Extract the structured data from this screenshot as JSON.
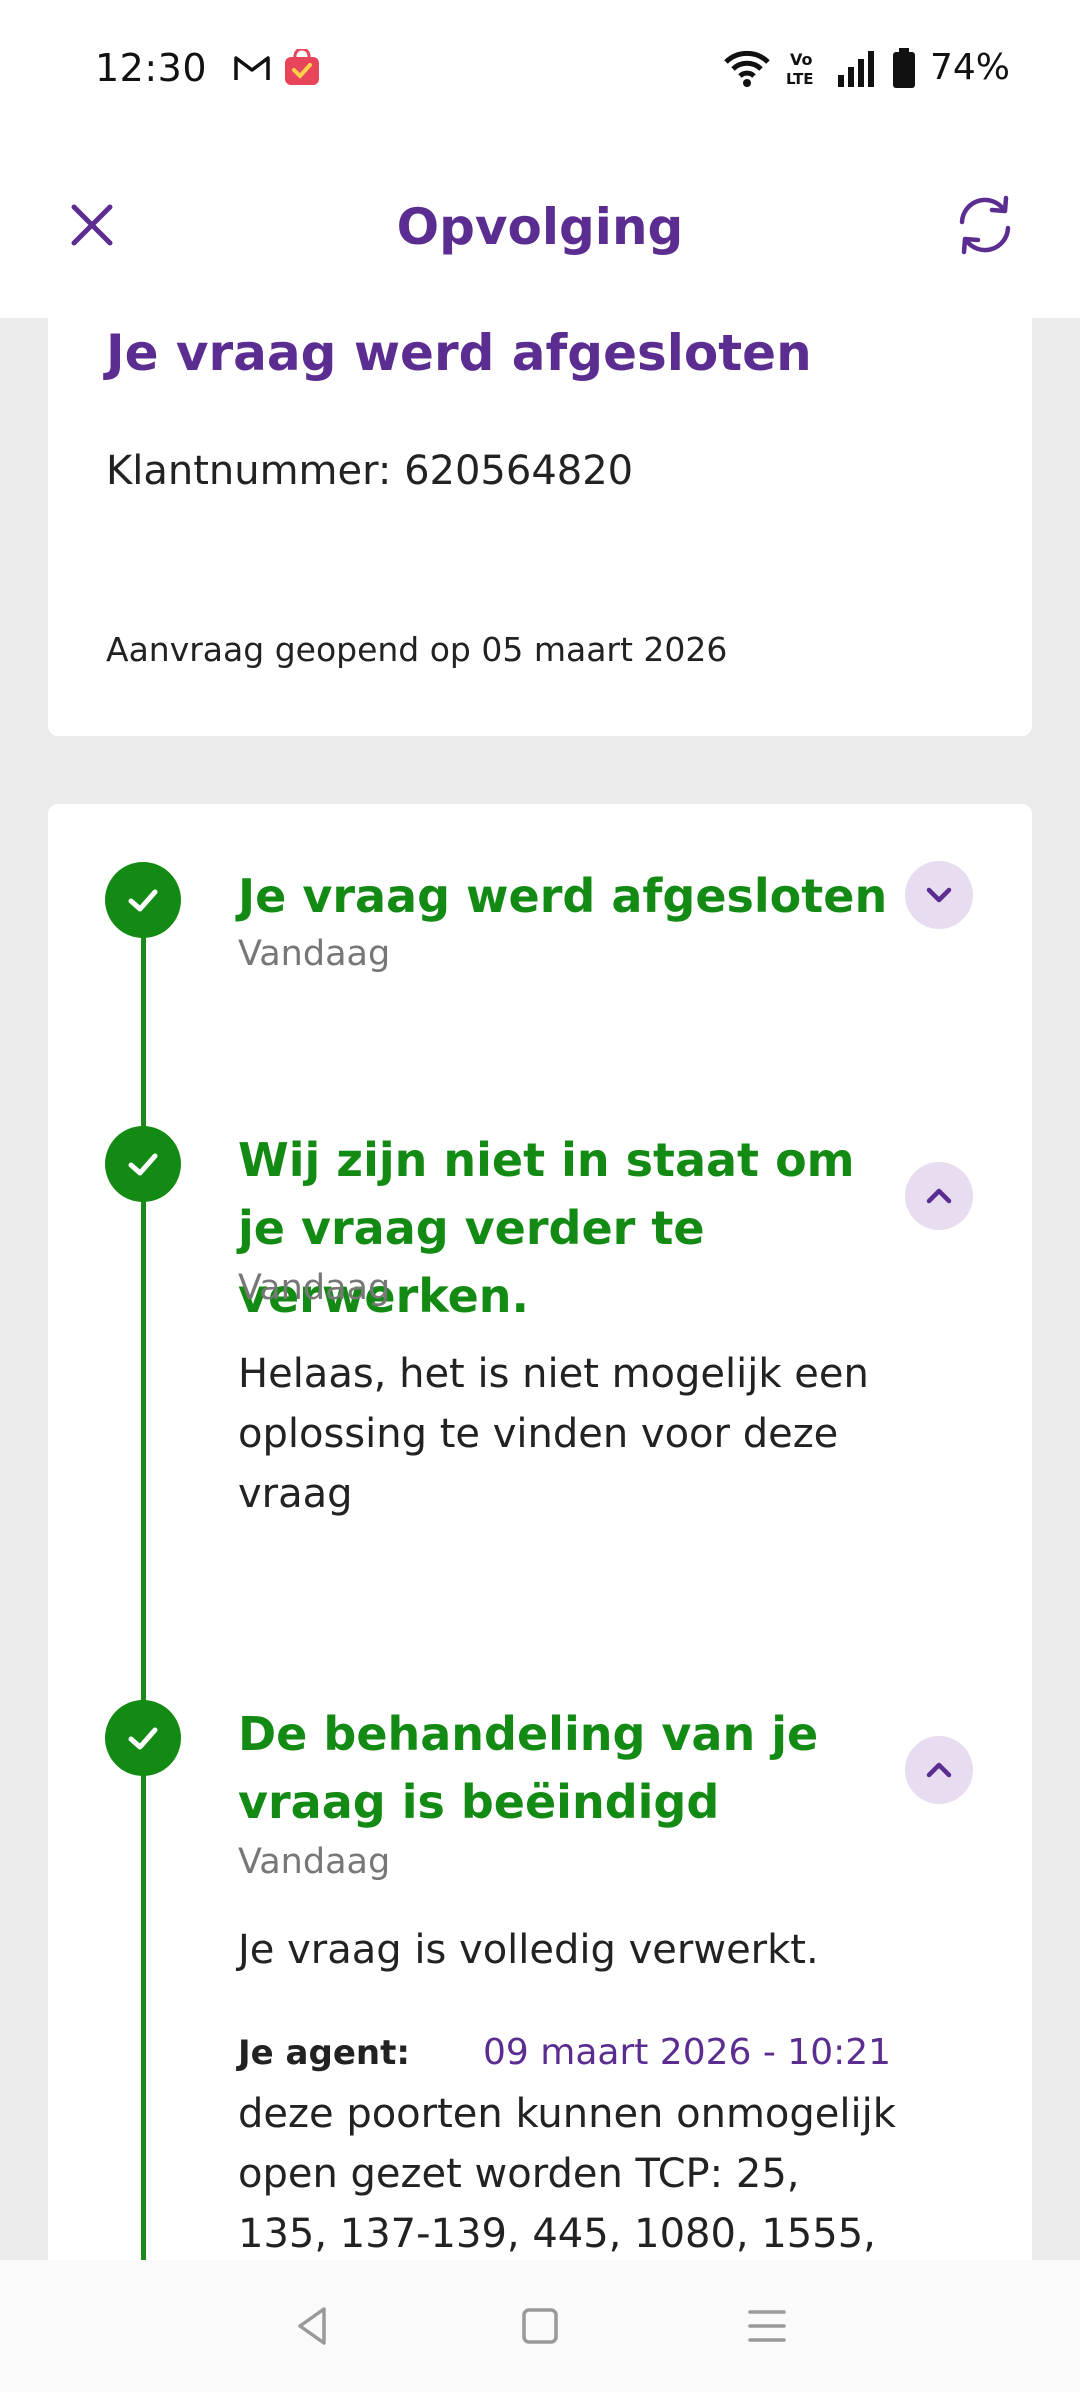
{
  "status_bar": {
    "time": "12:30",
    "battery": "74%",
    "network_label": "Vo LTE"
  },
  "header": {
    "title": "Opvolging",
    "close_icon": "close-icon",
    "refresh_icon": "refresh-icon"
  },
  "summary": {
    "title": "Je vraag werd afgesloten",
    "customer_number": "Klantnummer: 620564820",
    "opened": "Aanvraag geopend op 05 maart 2026"
  },
  "timeline": {
    "steps": [
      {
        "title": "Je vraag werd afgesloten",
        "date": "Vandaag",
        "expanded": false
      },
      {
        "title": "Wij zijn niet in staat om je vraag verder te verwerken.",
        "date": "Vandaag",
        "body": "Helaas, het is niet mogelijk een oplossing te vinden voor deze vraag",
        "expanded": true
      },
      {
        "title": "De behandeling van je vraag is beëindigd",
        "date": "Vandaag",
        "body": "Je vraag is volledig verwerkt.",
        "agent_label": "Je agent:",
        "agent_date": "09 maart 2026 - 10:21",
        "agent_message": "deze poorten kunnen onmogelijk open gezet worden TCP: 25, 135, 137-139, 445, 1080, 1555,",
        "expanded": true
      }
    ]
  },
  "colors": {
    "brand_purple": "#5c2d91",
    "success_green": "#138a13",
    "toggle_bg": "#e7dcf0"
  }
}
